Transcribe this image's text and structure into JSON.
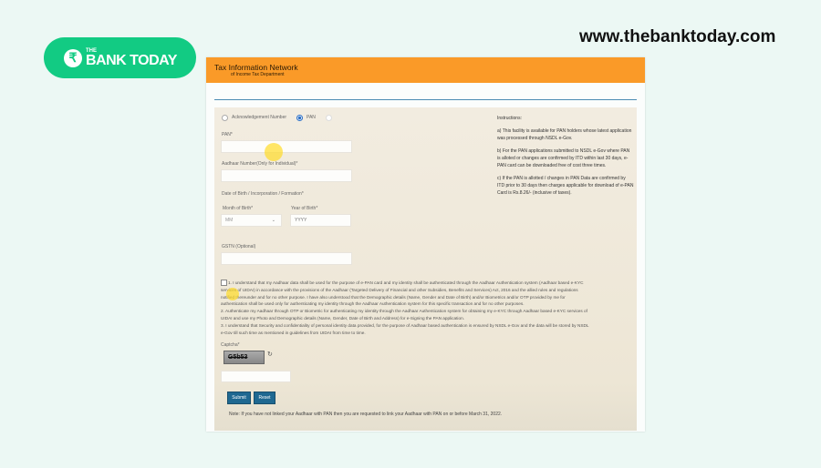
{
  "brand": {
    "logo_the": "THE",
    "logo_main": "BANK TODAY",
    "logo_icon": "rupee-icon",
    "site_url": "www.thebanktoday.com",
    "color": "#12cb83"
  },
  "header": {
    "title": "Tax Information Network",
    "subtitle": "of Income Tax Department",
    "color": "#fa9a28"
  },
  "form": {
    "radio_options": [
      {
        "label": "Acknowledgement Number",
        "checked": false
      },
      {
        "label": "PAN",
        "checked": true
      }
    ],
    "pan_label": "PAN*",
    "pan_value": "",
    "aadhaar_label": "Aadhaar Number(Only for Individual)*",
    "aadhaar_value": "",
    "dob_label": "Date of Birth / Incorporation / Formation*",
    "month_label": "Month of Birth*",
    "month_value": "MM",
    "year_label": "Year of Birth*",
    "year_placeholder": "YYYY",
    "gstn_label": "GSTN (Optional)",
    "gstn_value": "",
    "declaration": [
      "1. I understand that my Aadhaar data shall be used for the purpose of e-PAN card and my identity shall be authenticated through the Aadhaar Authentication system (Aadhaar based e-KYC",
      "services of UIDAI) in accordance with the provisions of the Aadhaar (Targeted Delivery of Financial and other Subsidies, Benefits and Services) Act, 2016 and the allied rules and regulations",
      "notified thereunder and for no other purpose. I have also understood that the Demographic details (Name, Gender and Date of Birth) and/or Biometrics and/or OTP provided by me for",
      "authentication shall be used only for authenticating my identity through the Aadhaar Authentication system for this specific transaction and for no other purposes.",
      "2. Authenticate my Aadhaar through OTP or Biometric for authenticating my identity through the Aadhaar Authentication system for obtaining my e-KYC through Aadhaar based e-KYC services of",
      "UIDAI and use my Photo and Demographic details (Name, Gender, Date of Birth and Address) for e-Signing the PAN application.",
      "3. I understand that Security and confidentiality of personal identity data provided, for the purpose of Aadhaar based authentication is ensured by NSDL e-Gov and the data will be stored by NSDL",
      "e-Gov till such time as mentioned in guidelines from UIDAI from time to time."
    ],
    "declaration_checked": false,
    "captcha_label": "Captcha*",
    "captcha_text": "G5b53",
    "captcha_input_value": "",
    "submit_label": "Submit",
    "reset_label": "Reset",
    "note": "Note: If you have not linked your Aadhaar with PAN then you are requested to link your Aadhaar with PAN on or before March 31, 2022."
  },
  "instructions": {
    "title": "Instructions:",
    "items": [
      "a) This facility is available for PAN holders whose latest application was processed through NSDL e-Gov.",
      "b) For the PAN applications submitted to NSDL e-Gov where PAN is alloted or changes are confirmed by ITD within last 30 days, e-PAN card can be downloaded free of cost three times.",
      "c) If the PAN is allotted / changes in PAN Data are confirmed by ITD prior to 30 days then charges applicable for download of e-PAN Card is Rs.8.26/- (inclusive of taxes)."
    ]
  }
}
